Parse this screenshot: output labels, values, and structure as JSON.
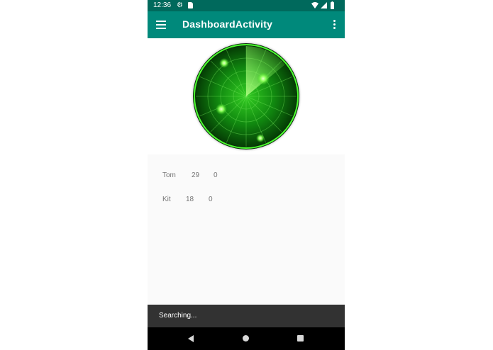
{
  "status_bar": {
    "time": "12:36",
    "color": "#00695c"
  },
  "app_bar": {
    "title": "DashboardActivity",
    "color": "#00897b",
    "icons": {
      "menu": "menu-icon",
      "overflow": "overflow-icon"
    }
  },
  "radar": {
    "icon": "radar-icon"
  },
  "list": {
    "rows": [
      {
        "name": "Tom",
        "age": "29",
        "value": "0"
      },
      {
        "name": "Kit",
        "age": "18",
        "value": "0"
      }
    ]
  },
  "snackbar": {
    "text": "Searching..."
  },
  "navigation": {
    "icons": [
      "back-icon",
      "home-icon",
      "recents-icon"
    ]
  }
}
